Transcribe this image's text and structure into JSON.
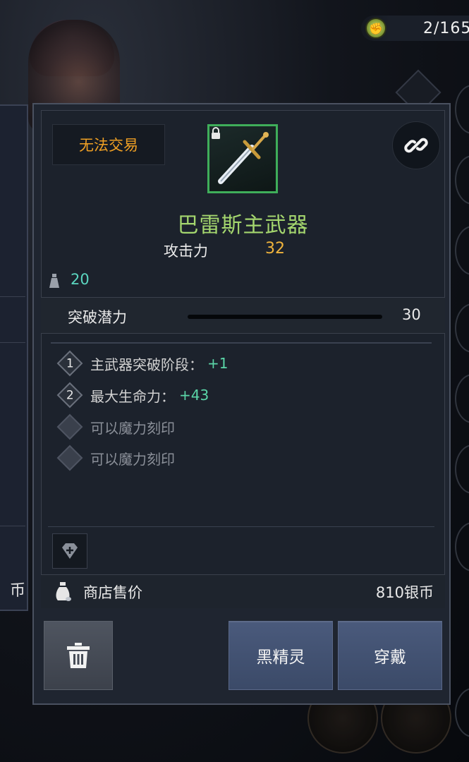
{
  "currency": {
    "value": "2/165",
    "icon": "fist-emblem-icon"
  },
  "background": {
    "left_panel_coin": "币"
  },
  "item": {
    "trade_status": "无法交易",
    "name": "巴雷斯主武器",
    "name_color": "#a4d66e",
    "frame_color": "#3fae5a",
    "stat_label": "攻击力",
    "stat_value": "32",
    "weight": "20",
    "potential_label": "突破潜力",
    "potential_value": "30",
    "effects": [
      {
        "index": "1",
        "text": "主武器突破阶段：",
        "bonus": "+1"
      },
      {
        "index": "2",
        "text": "最大生命力：",
        "bonus": "+43"
      },
      {
        "index": "",
        "text": "可以魔力刻印",
        "bonus": ""
      },
      {
        "index": "",
        "text": "可以魔力刻印",
        "bonus": ""
      }
    ],
    "price_label": "商店售价",
    "price_value": "810银币"
  },
  "buttons": {
    "dark_elf": "黑精灵",
    "equip": "穿戴"
  },
  "colors": {
    "trade_status": "#f0a024",
    "stat_value": "#f0b43c",
    "positive_bonus": "#5bd6a8",
    "button_blue": "#3b4a68"
  }
}
